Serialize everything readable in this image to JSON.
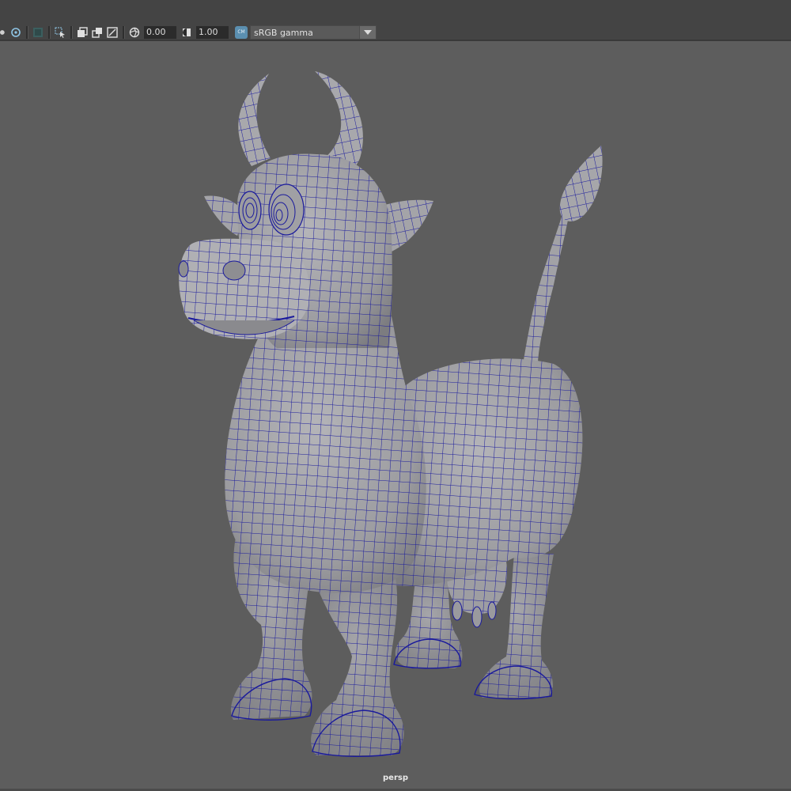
{
  "toolbar": {
    "exposure_value": "0.00",
    "gamma_value": "1.00",
    "color_management_label": "sRGB gamma",
    "icons": [
      "shading-icon",
      "isolate-icon",
      "grid-toggle-icon",
      "select-camera-icon",
      "xray-icon",
      "wireframe-icon",
      "resolution-gate-icon",
      "exposure-icon",
      "gamma-icon",
      "color-management-icon"
    ]
  },
  "viewport": {
    "camera_label": "persp",
    "background_color": "#5d5d5d",
    "mesh_fill": "#a3a3a7",
    "wireframe_color": "#1a1a9c"
  }
}
